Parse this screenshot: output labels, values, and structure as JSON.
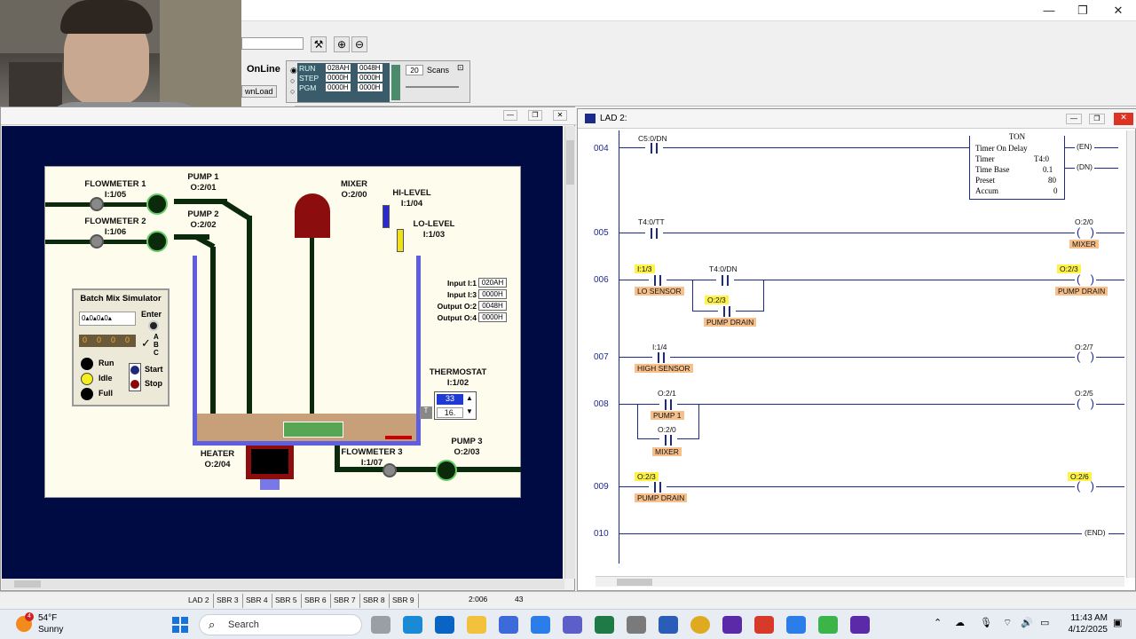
{
  "window": {
    "minimize": "—",
    "maximize": "❐",
    "close": "✕"
  },
  "toolbar": {
    "online": "OnLine",
    "download": "wnLoad",
    "modes": [
      "RUN",
      "STEP",
      "PGM"
    ],
    "hex_grid": [
      [
        "028AH",
        "0048H"
      ],
      [
        "0000H",
        "0000H"
      ],
      [
        "0000H",
        "0000H"
      ]
    ],
    "scans_value": "20",
    "scans_label": "Scans"
  },
  "sim": {
    "flowmeter1": "FLOWMETER 1\nI:1/05",
    "flowmeter2": "FLOWMETER 2\nI:1/06",
    "pump1": "PUMP 1\nO:2/01",
    "pump2": "PUMP 2\nO:2/02",
    "mixer": "MIXER\nO:2/00",
    "hilevel": "HI-LEVEL\nI:1/04",
    "lolevel": "LO-LEVEL\nI:1/03",
    "io": [
      {
        "label": "Input I:1",
        "value": "020AH"
      },
      {
        "label": "Input I:3",
        "value": "0000H"
      },
      {
        "label": "Output O:2",
        "value": "0048H"
      },
      {
        "label": "Output O:4",
        "value": "0000H"
      }
    ],
    "thermostat": "THERMOSTAT\nI:1/02",
    "thermo_set": "33",
    "thermo_act": "16.",
    "heater": "HEATER\nO:2/04",
    "flowmeter3": "FLOWMETER 3\nI:1/07",
    "pump3": "PUMP 3\nO:2/03",
    "batch_title": "Batch Mix Simulator",
    "enter": "Enter",
    "digits": [
      "0",
      "0",
      "0",
      "0"
    ],
    "abc": "A\nB\nC",
    "run": "Run",
    "idle": "Idle",
    "full": "Full",
    "start": "Start",
    "stop": "Stop"
  },
  "ladder": {
    "title": "LAD 2:",
    "rungs": [
      "004",
      "005",
      "006",
      "007",
      "008",
      "009",
      "010"
    ],
    "c5dn": "C5:0/DN",
    "ton": {
      "title": "TON",
      "name": "Timer On Delay",
      "rows": [
        [
          "Timer",
          "T4:0"
        ],
        [
          "Time Base",
          "0.1"
        ],
        [
          "Preset",
          "80"
        ],
        [
          "Accum",
          "0"
        ]
      ],
      "en": "EN",
      "dn": "DN"
    },
    "t4tt": "T4:0/TT",
    "o20": "O:2/0",
    "mixer": "MIXER",
    "i13": "I:1/3",
    "lo_sensor": "LO SENSOR",
    "t4dn": "T4:0/DN",
    "o23": "O:2/3",
    "pump_drain": "PUMP DRAIN",
    "i14": "I:1/4",
    "high_sensor": "HIGH SENSOR",
    "o27": "O:2/7",
    "o21": "O:2/1",
    "pump1": "PUMP 1",
    "o25": "O:2/5",
    "o26": "O:2/6",
    "end": "END"
  },
  "status_tabs": [
    "LAD 2",
    "SBR 3",
    "SBR 4",
    "SBR 5",
    "SBR 6",
    "SBR 7",
    "SBR 8",
    "SBR 9"
  ],
  "status": {
    "pos": "2:006",
    "num": "43"
  },
  "taskbar": {
    "weather_temp": "54°F",
    "weather_desc": "Sunny",
    "weather_badge": "4",
    "search": "Search",
    "time": "11:43 AM",
    "date": "4/12/2025"
  },
  "colors": {
    "sim_bg": "#000b44",
    "panel_bg": "#fefcec",
    "ladder_blue": "#1c2b8a",
    "highlight_yellow": "#fff34a",
    "tag_orange": "#f7c08a"
  }
}
